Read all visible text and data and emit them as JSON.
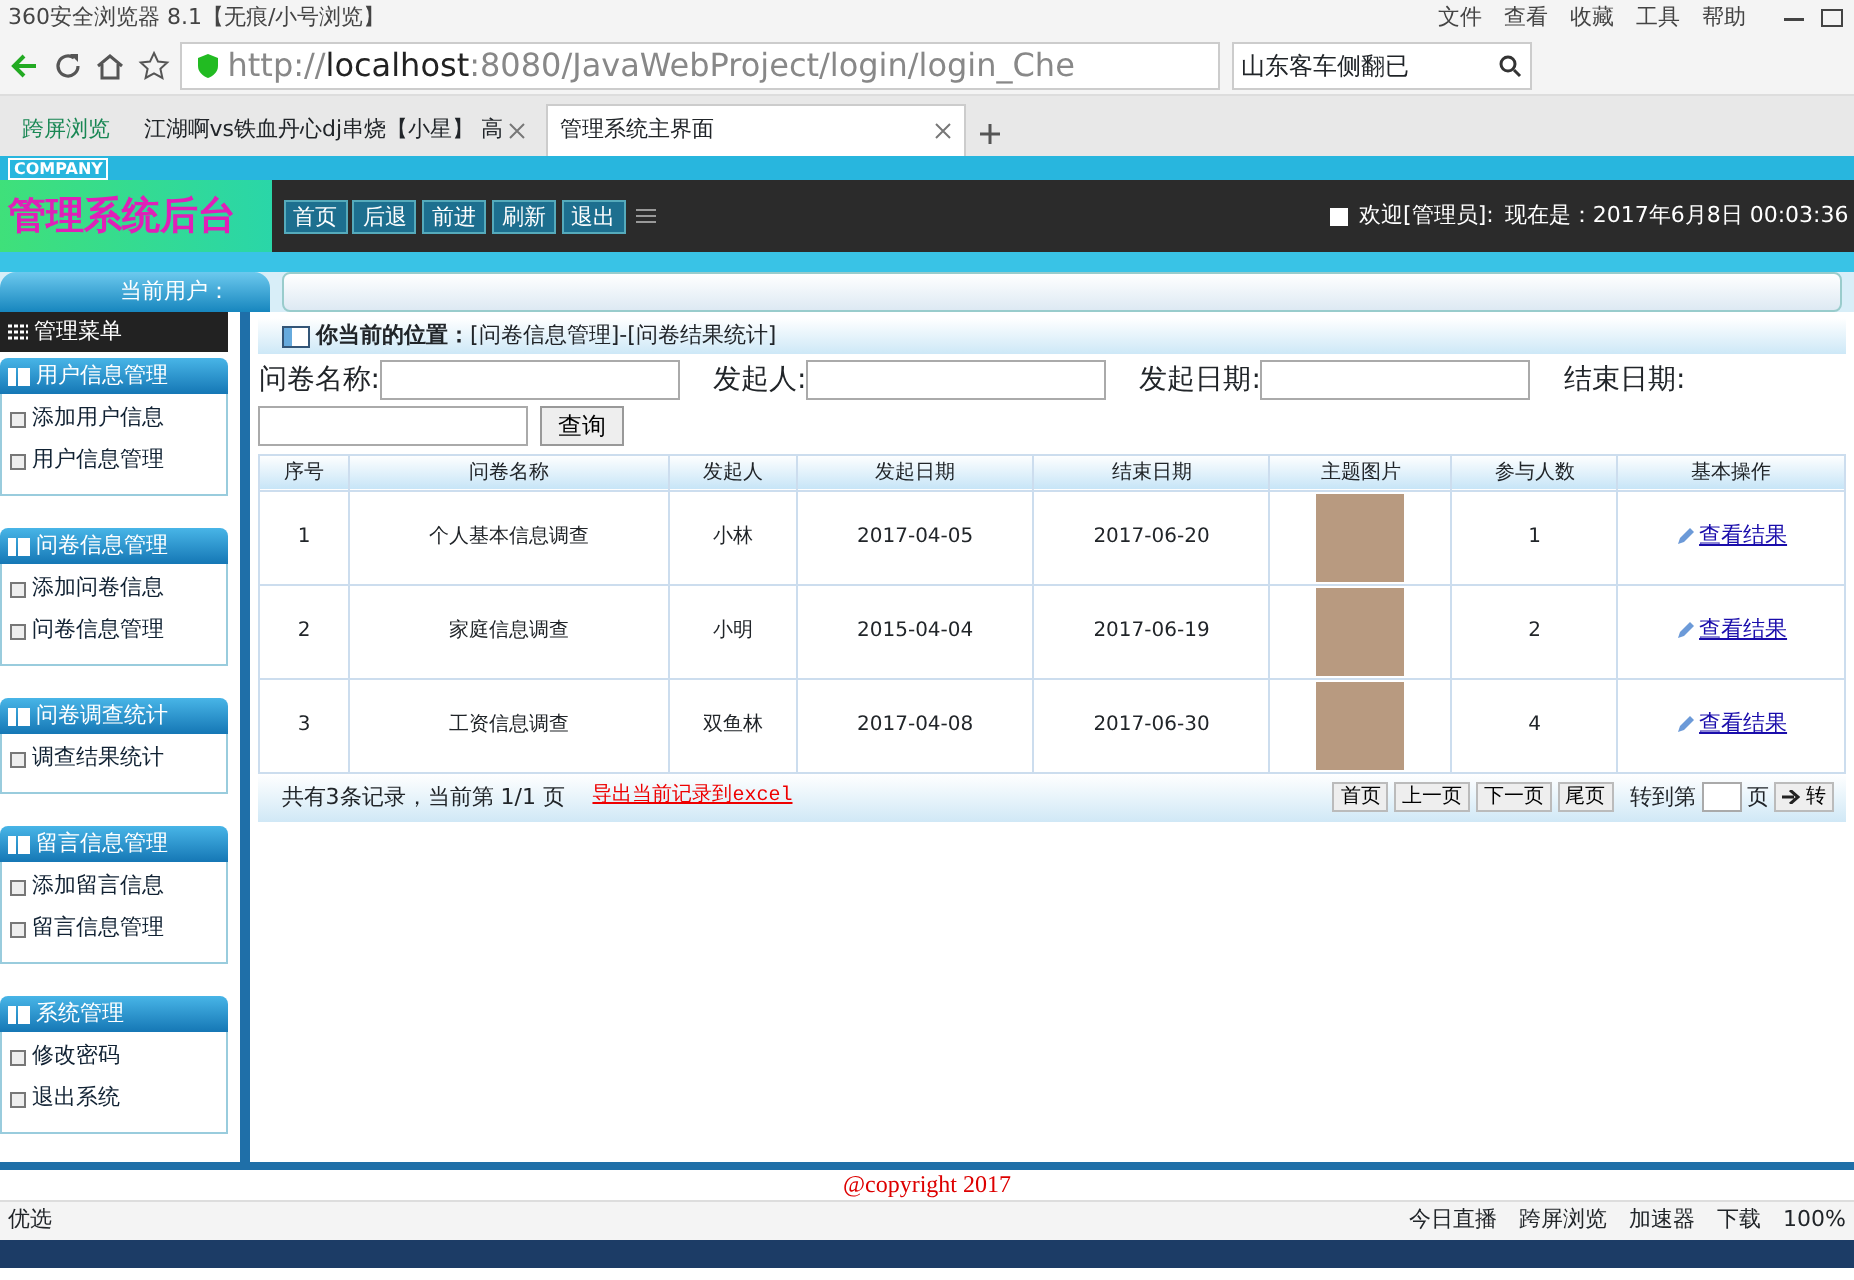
{
  "browser": {
    "title": "360安全浏览器 8.1【无痕/小号浏览】",
    "menu": [
      "文件",
      "查看",
      "收藏",
      "工具",
      "帮助"
    ],
    "url": "http://**localhost**:8080/JavaWebProject/login/login_Che",
    "search": "山东客车侧翻已",
    "bookmark": "跨屏浏览",
    "tabs": [
      {
        "label": "江湖啊vs铁血丹心dj串烧【小星】 高",
        "selected": false
      },
      {
        "label": "管理系统主界面",
        "selected": true
      }
    ]
  },
  "header": {
    "company": "COMPANY",
    "title": "管理系统后台",
    "nav": [
      "首页",
      "后退",
      "前进",
      "刷新",
      "退出"
    ],
    "welcome": "欢迎[管理员]:",
    "now": "现在是：2017年6月8日 00:03:36"
  },
  "current_user": "当前用户：",
  "sidebar": {
    "title": "管理菜单",
    "groups": [
      {
        "title": "用户信息管理",
        "items": [
          "添加用户信息",
          "用户信息管理"
        ]
      },
      {
        "title": "问卷信息管理",
        "items": [
          "添加问卷信息",
          "问卷信息管理"
        ]
      },
      {
        "title": "问卷调查统计",
        "items": [
          "调查结果统计"
        ]
      },
      {
        "title": "留言信息管理",
        "items": [
          "添加留言信息",
          "留言信息管理"
        ]
      },
      {
        "title": "系统管理",
        "items": [
          "修改密码",
          "退出系统"
        ]
      }
    ]
  },
  "breadcrumb": "**你当前的位置：**[问卷信息管理]-[问卷结果统计]",
  "search": {
    "fields": [
      "问卷名称:",
      "发起人:",
      "发起日期:",
      "结束日期:"
    ],
    "button": "查询"
  },
  "table": {
    "columns": [
      "序号",
      "问卷名称",
      "发起人",
      "发起日期",
      "结束日期",
      "主题图片",
      "参与人数",
      "基本操作"
    ],
    "rows": [
      {
        "no": "1",
        "name": "个人基本信息调查",
        "author": "小林",
        "start": "2017-04-05",
        "end": "2017-06-20",
        "count": "1",
        "action": "查看结果"
      },
      {
        "no": "2",
        "name": "家庭信息调查",
        "author": "小明",
        "start": "2015-04-04",
        "end": "2017-06-19",
        "count": "2",
        "action": "查看结果"
      },
      {
        "no": "3",
        "name": "工资信息调查",
        "author": "双鱼林",
        "start": "2017-04-08",
        "end": "2017-06-30",
        "count": "4",
        "action": "查看结果"
      }
    ]
  },
  "pager": {
    "summary": "共有3条记录，当前第 1/1 页",
    "export": "导出当前记录到excel",
    "buttons": [
      "首页",
      "上一页",
      "下一页",
      "尾页"
    ],
    "goto": "转到第",
    "page": "页",
    "go": "转"
  },
  "copyright": "@copyright 2017",
  "status_bar": {
    "left": "优选",
    "items": [
      "今日直播",
      "跨屏浏览",
      "加速器",
      "下载"
    ],
    "zoom": "100%"
  }
}
